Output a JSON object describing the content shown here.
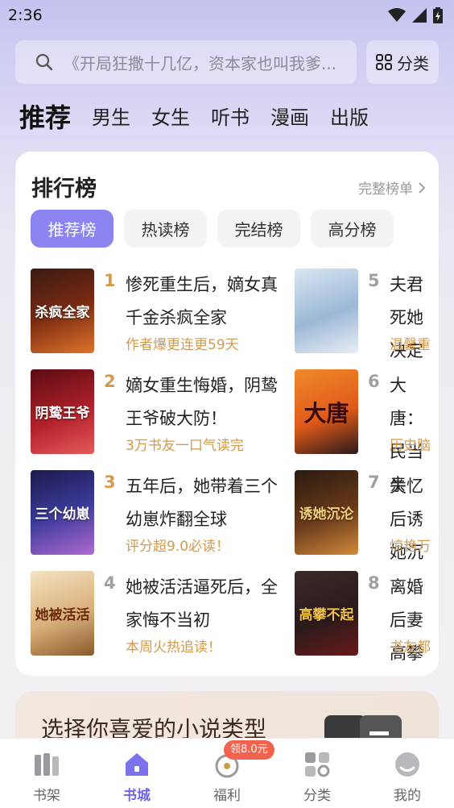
{
  "status": {
    "time": "2:36"
  },
  "search": {
    "placeholder": "《开局狂撒十几亿，资本家也叫我爹..."
  },
  "category_button": {
    "label": "分类"
  },
  "main_tabs": [
    "推荐",
    "男生",
    "女生",
    "听书",
    "漫画",
    "出版"
  ],
  "ranking": {
    "title": "排行榜",
    "more": "完整榜单",
    "tabs": [
      "推荐榜",
      "热读榜",
      "完结榜",
      "高分榜"
    ],
    "books": [
      {
        "rank": "1",
        "title": "惨死重生后，嫡女真千金杀疯全家",
        "tag": "作者爆更连更59天",
        "cover_text": "杀疯全家"
      },
      {
        "rank": "2",
        "title": "嫡女重生悔婚，阴鸷王爷破大防！",
        "tag": "3万书友一口气读完",
        "cover_text": "阴鸷王爷"
      },
      {
        "rank": "3",
        "title": "五年后，她带着三个幼崽炸翻全球",
        "tag": "评分超9.0必读！",
        "cover_text": "三个幼崽"
      },
      {
        "rank": "4",
        "title": "她被活活逼死后，全家悔不当初",
        "tag": "本周火热追读！",
        "cover_text": "她被活活"
      },
      {
        "rank": "5",
        "title": "夫君死她决定",
        "tag": "温馨重",
        "cover_text": ""
      },
      {
        "rank": "6",
        "title": "大唐：民当亲",
        "tag": "历史脑",
        "cover_text": "大唐"
      },
      {
        "rank": "7",
        "title": "失忆后诱她沉",
        "tag": "惊艳万",
        "cover_text": "诱她沉沦"
      },
      {
        "rank": "8",
        "title": "离婚后妻高攀",
        "tag": "书友都",
        "cover_text": "高攀不起"
      }
    ]
  },
  "genre_card": {
    "text": "选择你喜爱的小说类型"
  },
  "bottom_nav": {
    "items": [
      "书架",
      "书城",
      "福利",
      "分类",
      "我的"
    ],
    "badge": "领8.0元"
  },
  "colors": {
    "accent": "#8c84f0",
    "tag": "#d49a4c",
    "rank_top": "#d49a4c",
    "rank_other": "#a0a0a0"
  }
}
